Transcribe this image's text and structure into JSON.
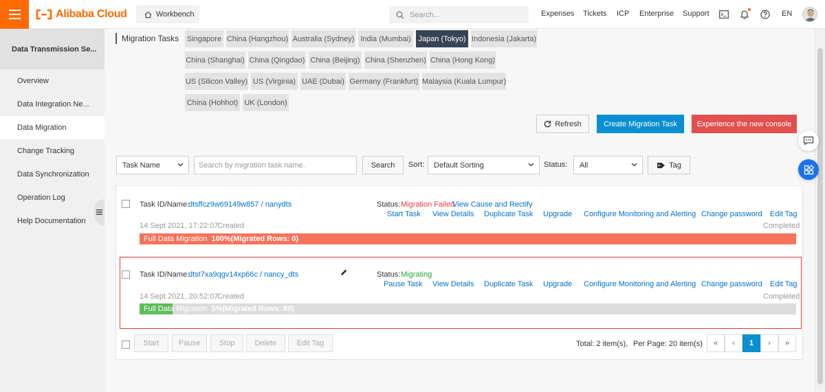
{
  "header": {
    "brand": "Alibaba Cloud",
    "workbench": "Workbench",
    "search_placeholder": "Search...",
    "nav": [
      "Expenses",
      "Tickets",
      "ICP",
      "Enterprise",
      "Support"
    ],
    "language": "EN"
  },
  "sidebar": {
    "title": "Data Transmission Se...",
    "items": [
      "Overview",
      "Data Integration  Ne...",
      "Data Migration",
      "Change Tracking",
      "Data Synchronization",
      "Operation Log",
      "Help Documentation"
    ],
    "active_index": 2
  },
  "page": {
    "heading": "Migration Tasks",
    "regions": [
      "Singapore",
      "China (Hangzhou)",
      "Australia (Sydney)",
      "India (Mumbai)",
      "Japan (Tokyo)",
      "Indonesia (Jakarta)",
      "China (Shanghai)",
      "China (Qingdao)",
      "China (Beijing)",
      "China (Shenzhen)",
      "China (Hong Kong)",
      "US (Silicon Valley)",
      "US (Virginia)",
      "UAE (Dubai)",
      "Germany (Frankfurt)",
      "Malaysia (Kuala Lumpur)",
      "China (Hohhot)",
      "UK (London)"
    ],
    "active_region": "Japan (Tokyo)",
    "actions": {
      "refresh": "Refresh",
      "create": "Create Migration Task",
      "new_console": "Experience the new console"
    }
  },
  "filters": {
    "field": "Task Name",
    "search_placeholder": "Search by migration task name.",
    "search_button": "Search",
    "sort_label": "Sort:",
    "sort_value": "Default Sorting",
    "status_label": "Status:",
    "status_value": "All",
    "tag_button": "Tag"
  },
  "tasks": [
    {
      "id_label": "Task ID/Name:",
      "id": "dtsffcz9w69149w857 / nanydts",
      "status_label": "Status:",
      "status": "Migration Failed",
      "status_link": "View Cause and Rectify",
      "actions": [
        "Start Task",
        "View Details",
        "Duplicate Task",
        "Upgrade",
        "Configure Monitoring and Alerting",
        "Change password",
        "Edit Tag"
      ],
      "created": "14 Sept 2021, 17:22:07",
      "created_suffix": "Created",
      "state": "Completed",
      "progress_label": "Full Data Migration",
      "progress_detail": "100%(Migrated Rows: 0)",
      "progress": 1.0,
      "color": "#f5735b"
    },
    {
      "id_label": "Task ID/Name:",
      "id": "dtst7xa9qgv14xp66c / nancy_dts",
      "status_label": "Status:",
      "status": "Migrating",
      "actions": [
        "Pause Task",
        "View Details",
        "Duplicate Task",
        "Upgrade",
        "Configure Monitoring and Alerting",
        "Change password",
        "Edit Tag"
      ],
      "created": "14 Sept 2021, 20:52:07",
      "created_suffix": "Created",
      "state": "Completed",
      "progress_label": "Full Data Migration",
      "progress_detail": "5%(Migrated Rows: 89)",
      "progress": 0.05,
      "color": "#5cbd5c"
    }
  ],
  "batch_actions": [
    "Start",
    "Pause",
    "Stop",
    "Delete",
    "Edit Tag"
  ],
  "pagination": {
    "total": "Total: 2 item(s),",
    "per_page": "Per Page: 20 item(s)",
    "first": "«",
    "prev": "‹",
    "current": "1",
    "next": "›",
    "last": "»"
  },
  "colors": {
    "brand": "#ff6a00",
    "primary": "#0b8fd1",
    "danger": "#e14f4f",
    "active_region": "#374454"
  }
}
